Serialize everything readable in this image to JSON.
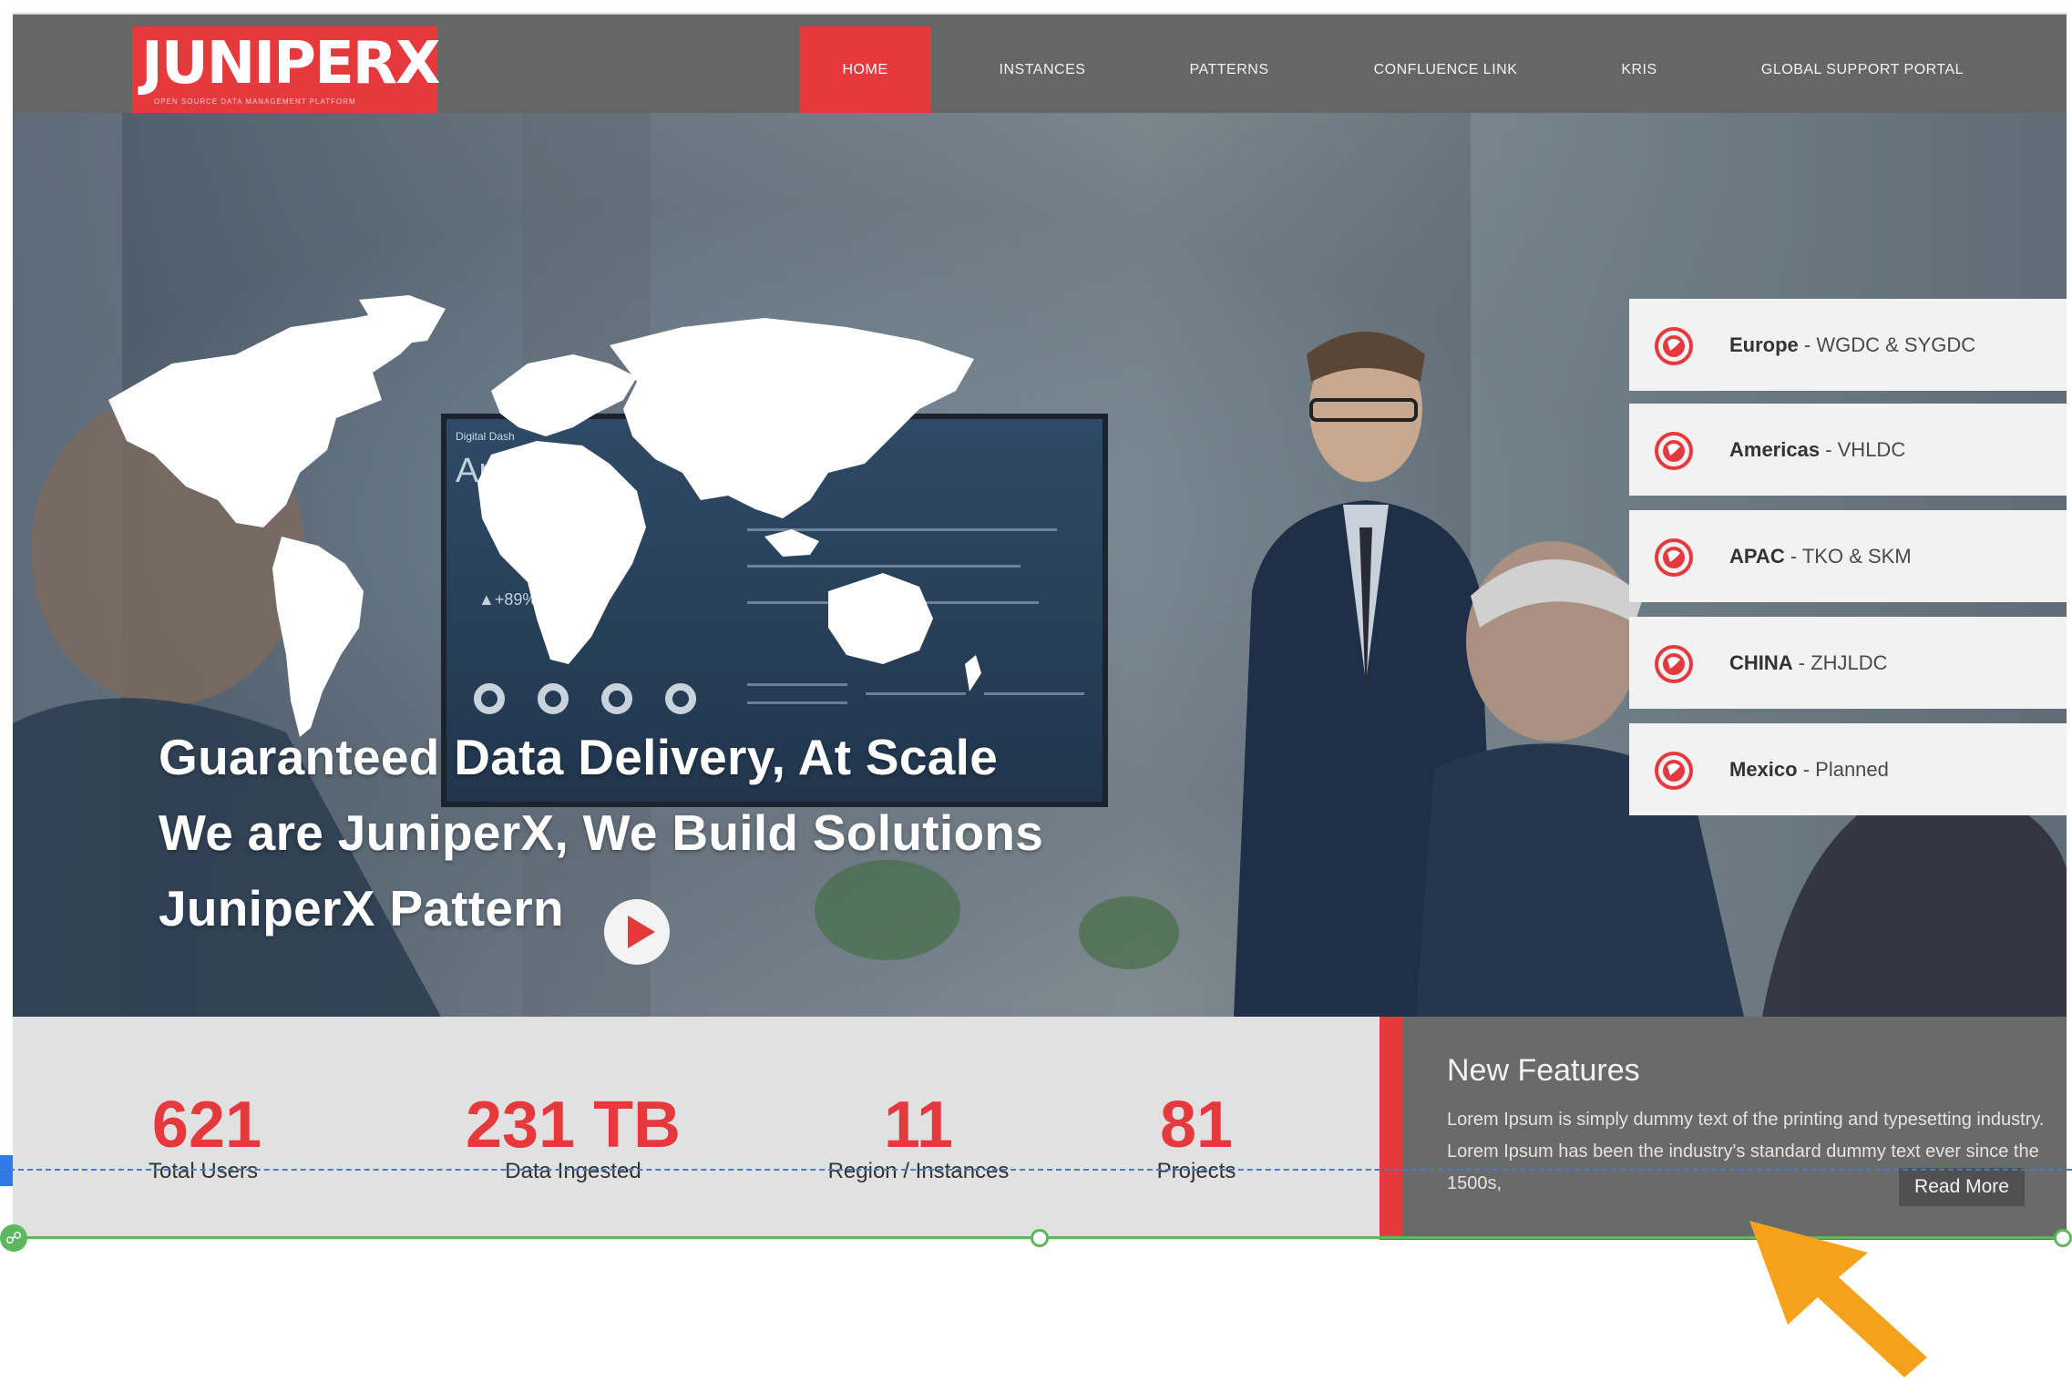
{
  "logo": {
    "text": "JUNIPERX",
    "tagline": "OPEN SOURCE DATA MANAGEMENT PLATFORM"
  },
  "nav": {
    "items": [
      {
        "label": "HOME",
        "active": true
      },
      {
        "label": "INSTANCES"
      },
      {
        "label": "PATTERNS"
      },
      {
        "label": "CONFLUENCE LINK"
      },
      {
        "label": "KRIS"
      },
      {
        "label": "GLOBAL SUPPORT PORTAL"
      }
    ]
  },
  "hero": {
    "line1": "Guaranteed Data Delivery, At Scale",
    "line2": "We are JuniperX, We Build Solutions",
    "line3": "JuniperX Pattern",
    "screen_title": "Ana",
    "screen_caption": "Digital Dash",
    "screen_metric": "▲+89%"
  },
  "regions": [
    {
      "name": "Europe",
      "detail": " - WGDC & SYGDC"
    },
    {
      "name": "Americas",
      "detail": " - VHLDC"
    },
    {
      "name": "APAC",
      "detail": " - TKO & SKM"
    },
    {
      "name": "CHINA",
      "detail": " - ZHJLDC"
    },
    {
      "name": "Mexico",
      "detail": " - Planned"
    }
  ],
  "stats": [
    {
      "value": "621",
      "label": "Total Users"
    },
    {
      "value": "231 TB",
      "label": "Data Ingested"
    },
    {
      "value": "11",
      "label": "Region / Instances"
    },
    {
      "value": "81",
      "label": "Projects"
    }
  ],
  "features": {
    "title": "New Features",
    "body": "Lorem Ipsum is simply dummy text of the printing and typesetting industry. Lorem Ipsum has been the industry's standard dummy text ever since the 1500s,",
    "button": "Read More"
  },
  "colors": {
    "accent": "#e5393e",
    "header": "#666666",
    "stats_bg": "#e1e1e1",
    "features_bg": "#6a6a6a",
    "callout_arrow": "#f5a21b",
    "selection": "#5cb85c",
    "guide": "#3d7fd6"
  }
}
